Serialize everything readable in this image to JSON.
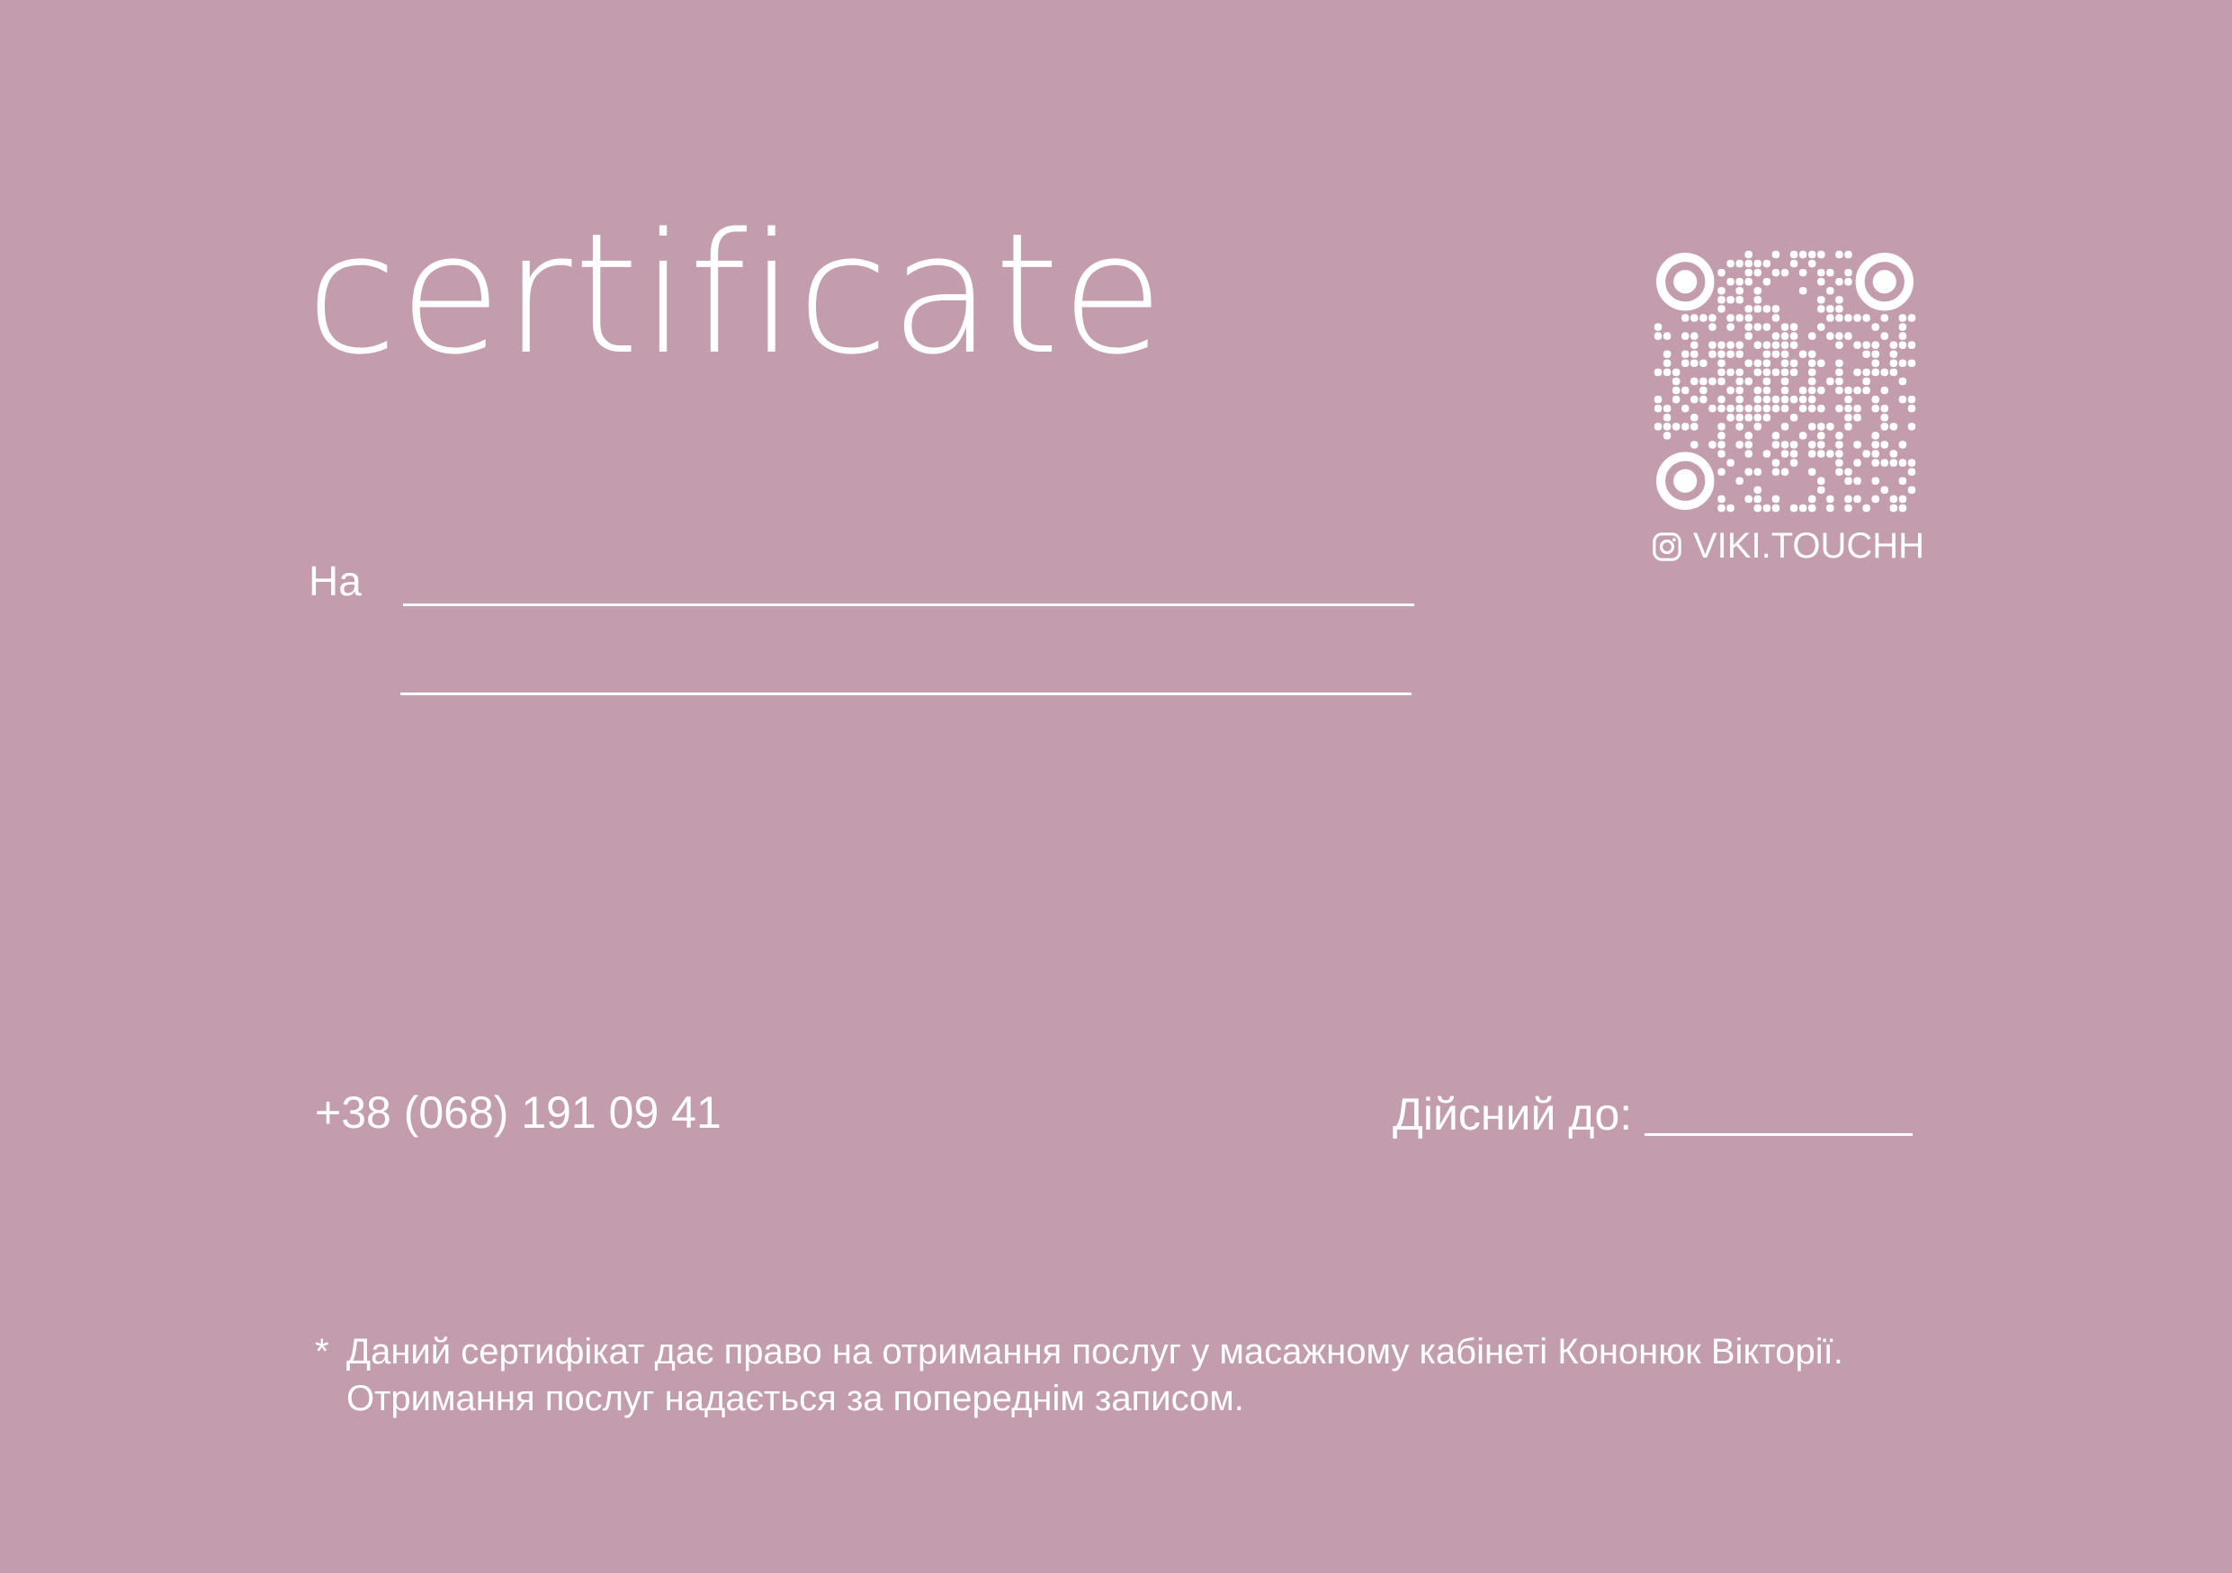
{
  "colors": {
    "background": "#c39cad",
    "foreground": "#ffffff"
  },
  "certificate": {
    "title": "certificate",
    "recipient_label": "На",
    "phone": "+38 (068) 191 09 41",
    "valid_until_label": "Дійсний до:",
    "footnote": {
      "marker": "*",
      "line1": "Даний сертифікат дає право на отримання послуг у масажному кабінеті Кононюк Вікторії.",
      "line2": "Отримання послуг надається за попереднім записом."
    }
  },
  "social": {
    "icon": "instagram-icon",
    "handle": "VIKI.TOUCHH"
  },
  "qr": {
    "icon": "qr-code"
  }
}
